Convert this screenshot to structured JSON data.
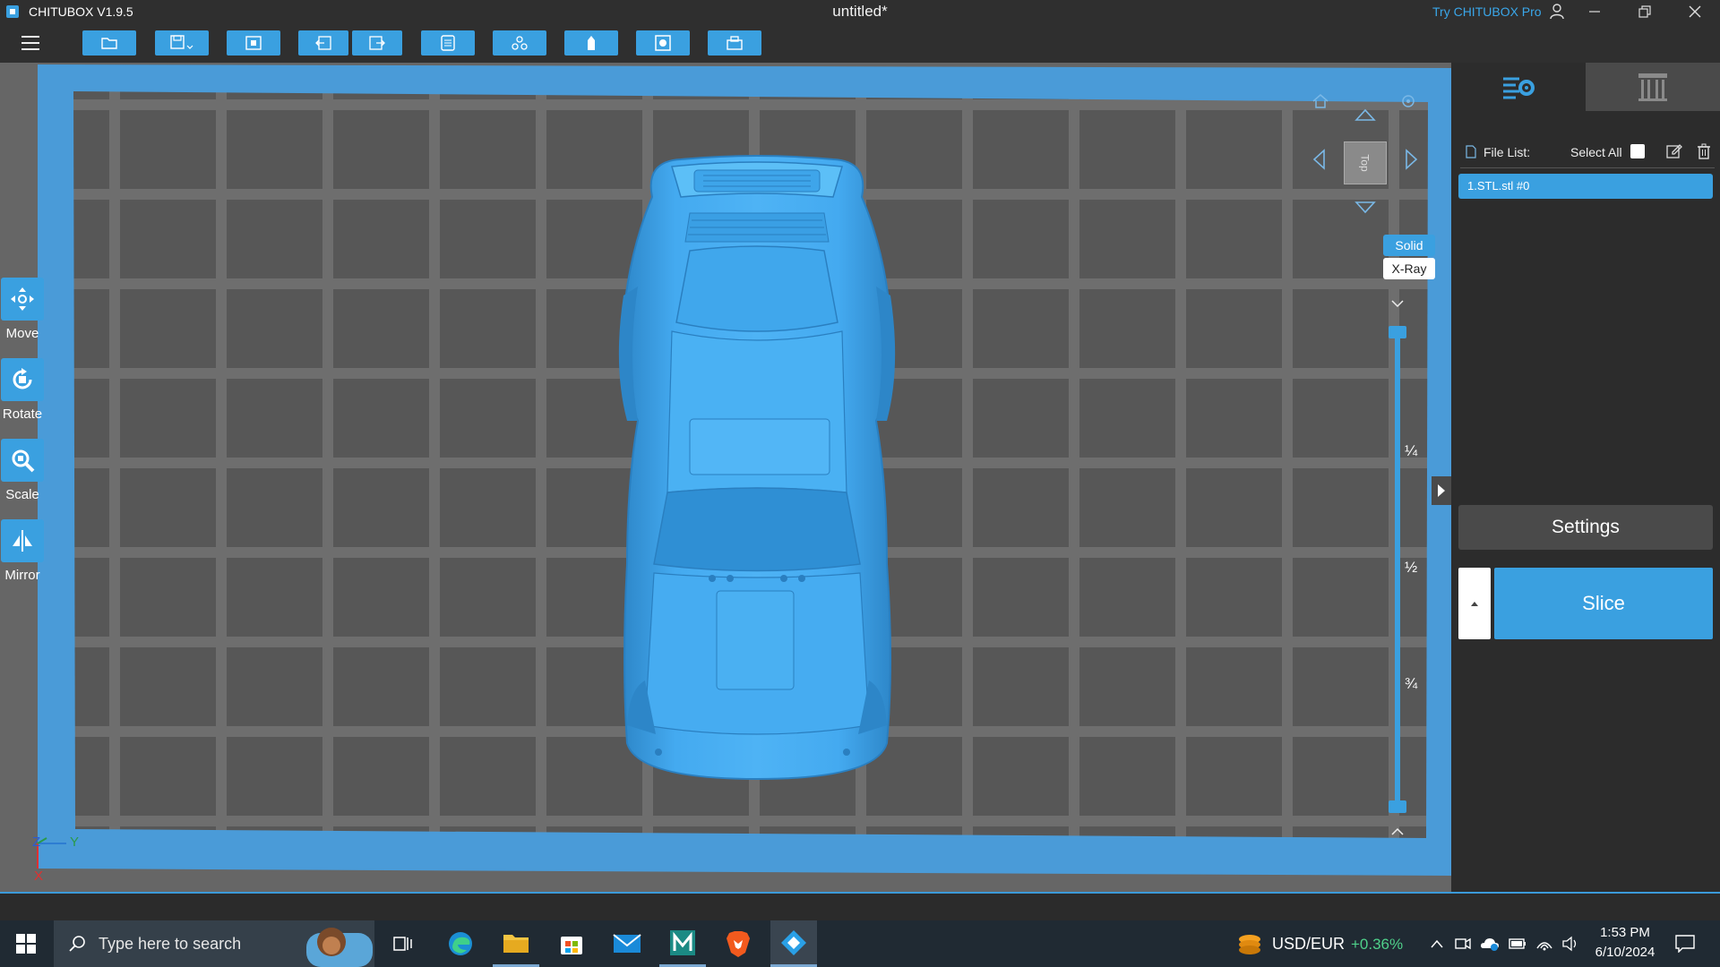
{
  "app": {
    "title": "CHITUBOX V1.9.5",
    "document_title": "untitled*",
    "try_pro": "Try CHITUBOX Pro"
  },
  "toolbar": {
    "buttons": [
      "menu-icon",
      "open-file-icon",
      "save-icon",
      "screenshot-icon",
      "undo-icon",
      "redo-icon",
      "arrange-icon",
      "auto-layout-icon",
      "support-icon",
      "hollow-icon",
      "print-icon"
    ]
  },
  "side_tools": [
    {
      "label": "Move",
      "icon": "move-icon"
    },
    {
      "label": "Rotate",
      "icon": "rotate-icon"
    },
    {
      "label": "Scale",
      "icon": "scale-icon"
    },
    {
      "label": "Mirror",
      "icon": "mirror-icon"
    }
  ],
  "view": {
    "cube_label": "Top",
    "render_modes": [
      "Solid",
      "X-Ray"
    ],
    "active_render_mode": "Solid",
    "slider_marks": [
      "¼",
      "½",
      "¾"
    ],
    "axes": {
      "z": "Z",
      "y": "Y",
      "x": "X"
    }
  },
  "file_list": {
    "label": "File List:",
    "select_all": "Select All",
    "items": [
      "1.STL.stl #0"
    ]
  },
  "actions": {
    "settings": "Settings",
    "slice": "Slice"
  },
  "taskbar": {
    "search_placeholder": "Type here to search",
    "ticker_label": "USD/EUR",
    "ticker_value": "+0.36%",
    "time": "1:53 PM",
    "date": "6/10/2024"
  },
  "colors": {
    "accent": "#3aa0e0",
    "model": "#3fa5ea",
    "bed": "#5a5a5a",
    "grid": "#6e6e6e",
    "ticker_up": "#4fd08a"
  }
}
